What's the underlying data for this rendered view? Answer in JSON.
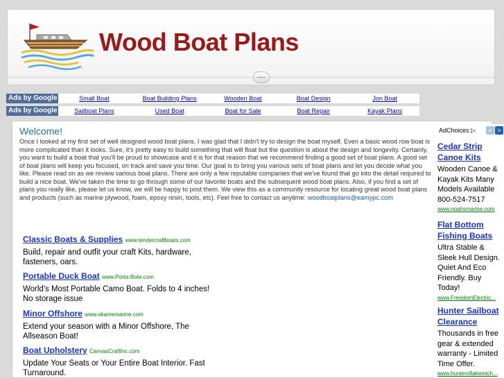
{
  "site": {
    "title": "Wood Boat Plans"
  },
  "ads_label": "Ads by Google",
  "ad_links_row1": [
    "Small Boat",
    "Boat Building Plans",
    "Wooden Boat",
    "Boat Design",
    "Jon Boat"
  ],
  "ad_links_row2": [
    "Sailboat Plans",
    "Used Boat",
    "Boat for Sale",
    "Boat Repair",
    "Kayak Plans"
  ],
  "welcome": {
    "title": "Welcome!",
    "body": "Once I looked at my first set of well designed wood boat plans, I was glad that I didn't try to design the boat myself. Even a basic wood row boat is more complicated than it looks. Sure, it's pretty easy to build something that will float but the question is about the design and longevity. Certainly, you want to build a boat that you'll be proud to showcase and it is for that reason that we recommend finding a good set of boat plans. A good set of boat plans will keep you focused, on track and save you time. Our goal is to bring you various sets of boat plans and let you decide what you like. Please read on as we review various boat plans. There are only a few reputable companies that we've found that go into the detail required to build a nice boat. We've taken the time to go through some of our favorite boats and the subsequent wood boat plans. Also, if you find a set of plans you really like, please let us know, we will be happy to post them. We view this as a community resource for locating great wood boat plans and products (such as marine plywood, foam, epoxy resin, tools, etc). Feel free to contact us anytime: ",
    "email": "woodboatplans@eamypc.com"
  },
  "ads": [
    {
      "title": "Classic Boats & Supplies",
      "url": "www.tendercraftboats.com",
      "desc": "Build, repair and outfit your craft Kits, hardware, fasteners, oars."
    },
    {
      "title": "Portable Duck Boat",
      "url": "www.Porta-Bote.com",
      "desc": "World's Most Portable Camo Boat. Folds to 4 inches! No storage issue"
    },
    {
      "title": "Minor Offshore",
      "url": "www.skamemarine.com",
      "desc": "Extend your season with a Minor Offshore, The Allseason Boat!"
    },
    {
      "title": "Boat Upholstery",
      "url": "CanvasCraftInc.com",
      "desc": "Update Your Seats or Your Entire Boat Interior. Fast Turnaround."
    }
  ],
  "adchoices": {
    "label": "AdChoices",
    "prev": "<",
    "next": ">",
    "ads": [
      {
        "title": "Cedar Strip Canoe Kits",
        "desc": "Wooden Canoe & Kayak Kits Many Models Available 800-524-7517",
        "url": "www.noahsmarine.com"
      },
      {
        "title": "Flat Bottom Fishing Boats",
        "desc": "Ultra Stable & Sleek Hull Design. Quiet And Eco Friendly. Buy Today!",
        "url": "www.FreedomElectric..."
      },
      {
        "title": "Hunter Sailboat Clearance",
        "desc": "Thousands in free gear & extended warranty - Limited Time Offer.",
        "url": "www.hunterofiakemich..."
      }
    ]
  },
  "colors": {
    "title_red": "#9a1a1a",
    "link_blue": "#1a33cc",
    "url_green": "#008000",
    "ads_label_bg": "#4f6d9a"
  }
}
